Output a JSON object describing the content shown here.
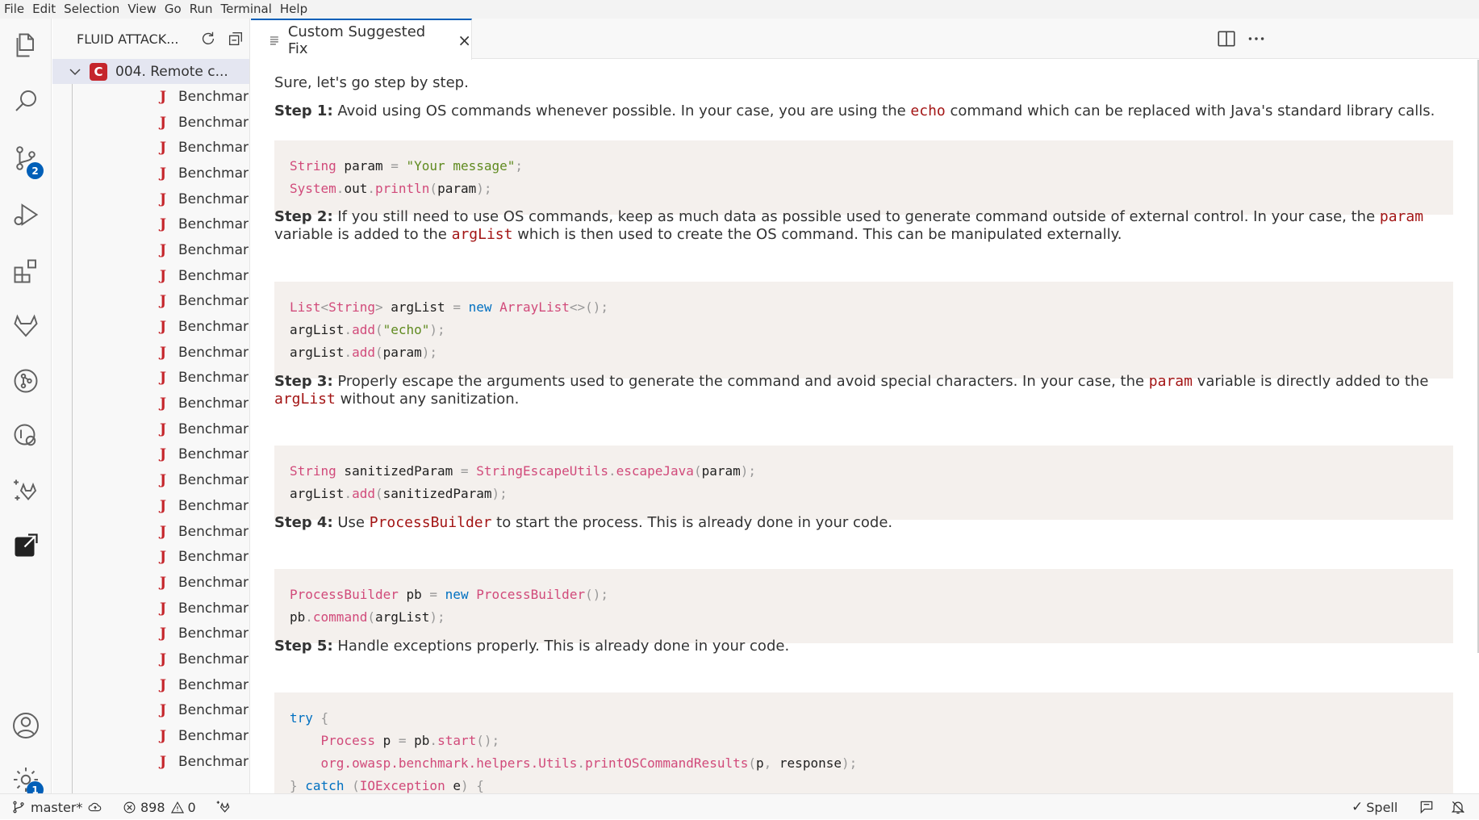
{
  "menu": [
    "File",
    "Edit",
    "Selection",
    "View",
    "Go",
    "Run",
    "Terminal",
    "Help"
  ],
  "activity": {
    "scm_badge": "2",
    "settings_badge": "1"
  },
  "sidebar": {
    "title": "FLUID ATTACK...",
    "root_label": "004. Remote c...",
    "root_icon_letter": "C",
    "file_icon": "J",
    "items": [
      "BenchmarkTe...",
      "BenchmarkTe...",
      "BenchmarkTe...",
      "BenchmarkTe...",
      "BenchmarkTe...",
      "BenchmarkTe...",
      "BenchmarkTe...",
      "BenchmarkTe...",
      "BenchmarkTe...",
      "BenchmarkTe...",
      "BenchmarkTe...",
      "BenchmarkTe...",
      "BenchmarkTe...",
      "BenchmarkTe...",
      "BenchmarkTe...",
      "BenchmarkTe...",
      "BenchmarkTe...",
      "BenchmarkTe...",
      "BenchmarkTe...",
      "BenchmarkTe...",
      "BenchmarkTe...",
      "BenchmarkTe...",
      "BenchmarkTe...",
      "BenchmarkTe...",
      "BenchmarkTe...",
      "BenchmarkTe...",
      "BenchmarkTe..."
    ]
  },
  "tab": {
    "label": "Custom Suggested Fix",
    "close": "×"
  },
  "content": {
    "intro": "Sure, let's go step by step.",
    "step1": {
      "label": "Step 1:",
      "text_a": " Avoid using OS commands whenever possible. In your case, you are using the ",
      "code_a": "echo",
      "text_b": " command which can be replaced with Java's standard library calls."
    },
    "step2": {
      "label": "Step 2:",
      "text_a": " If you still need to use OS commands, keep as much data as possible used to generate command outside of external control. In your case, the ",
      "code_a": "param",
      "text_b": " variable is added to the ",
      "code_b": "argList",
      "text_c": " which is then used to create the OS command. This can be manipulated externally."
    },
    "step3": {
      "label": "Step 3:",
      "text_a": " Properly escape the arguments used to generate the command and avoid special characters. In your case, the ",
      "code_a": "param",
      "text_b": " variable is directly added to the ",
      "code_b": "argList",
      "text_c": " without any sanitization."
    },
    "step4": {
      "label": "Step 4:",
      "text_a": " Use ",
      "code_a": "ProcessBuilder",
      "text_b": " to start the process. This is already done in your code."
    },
    "step5": {
      "label": "Step 5:",
      "text_a": " Handle exceptions properly. This is already done in your code."
    },
    "code1": [
      "String param = \"Your message\";",
      "System.out.println(param);"
    ],
    "code2": [
      "List<String> argList = new ArrayList<>();",
      "argList.add(\"echo\");",
      "argList.add(param);"
    ],
    "code3": [
      "String sanitizedParam = StringEscapeUtils.escapeJava(param);",
      "argList.add(sanitizedParam);"
    ],
    "code4": [
      "ProcessBuilder pb = new ProcessBuilder();",
      "pb.command(argList);"
    ],
    "code5": [
      "try {",
      "    Process p = pb.start();",
      "    org.owasp.benchmark.helpers.Utils.printOSCommandResults(p, response);",
      "} catch (IOException e) {"
    ]
  },
  "status": {
    "branch": "master*",
    "errors": "898",
    "warnings": "0",
    "spell": "Spell"
  }
}
